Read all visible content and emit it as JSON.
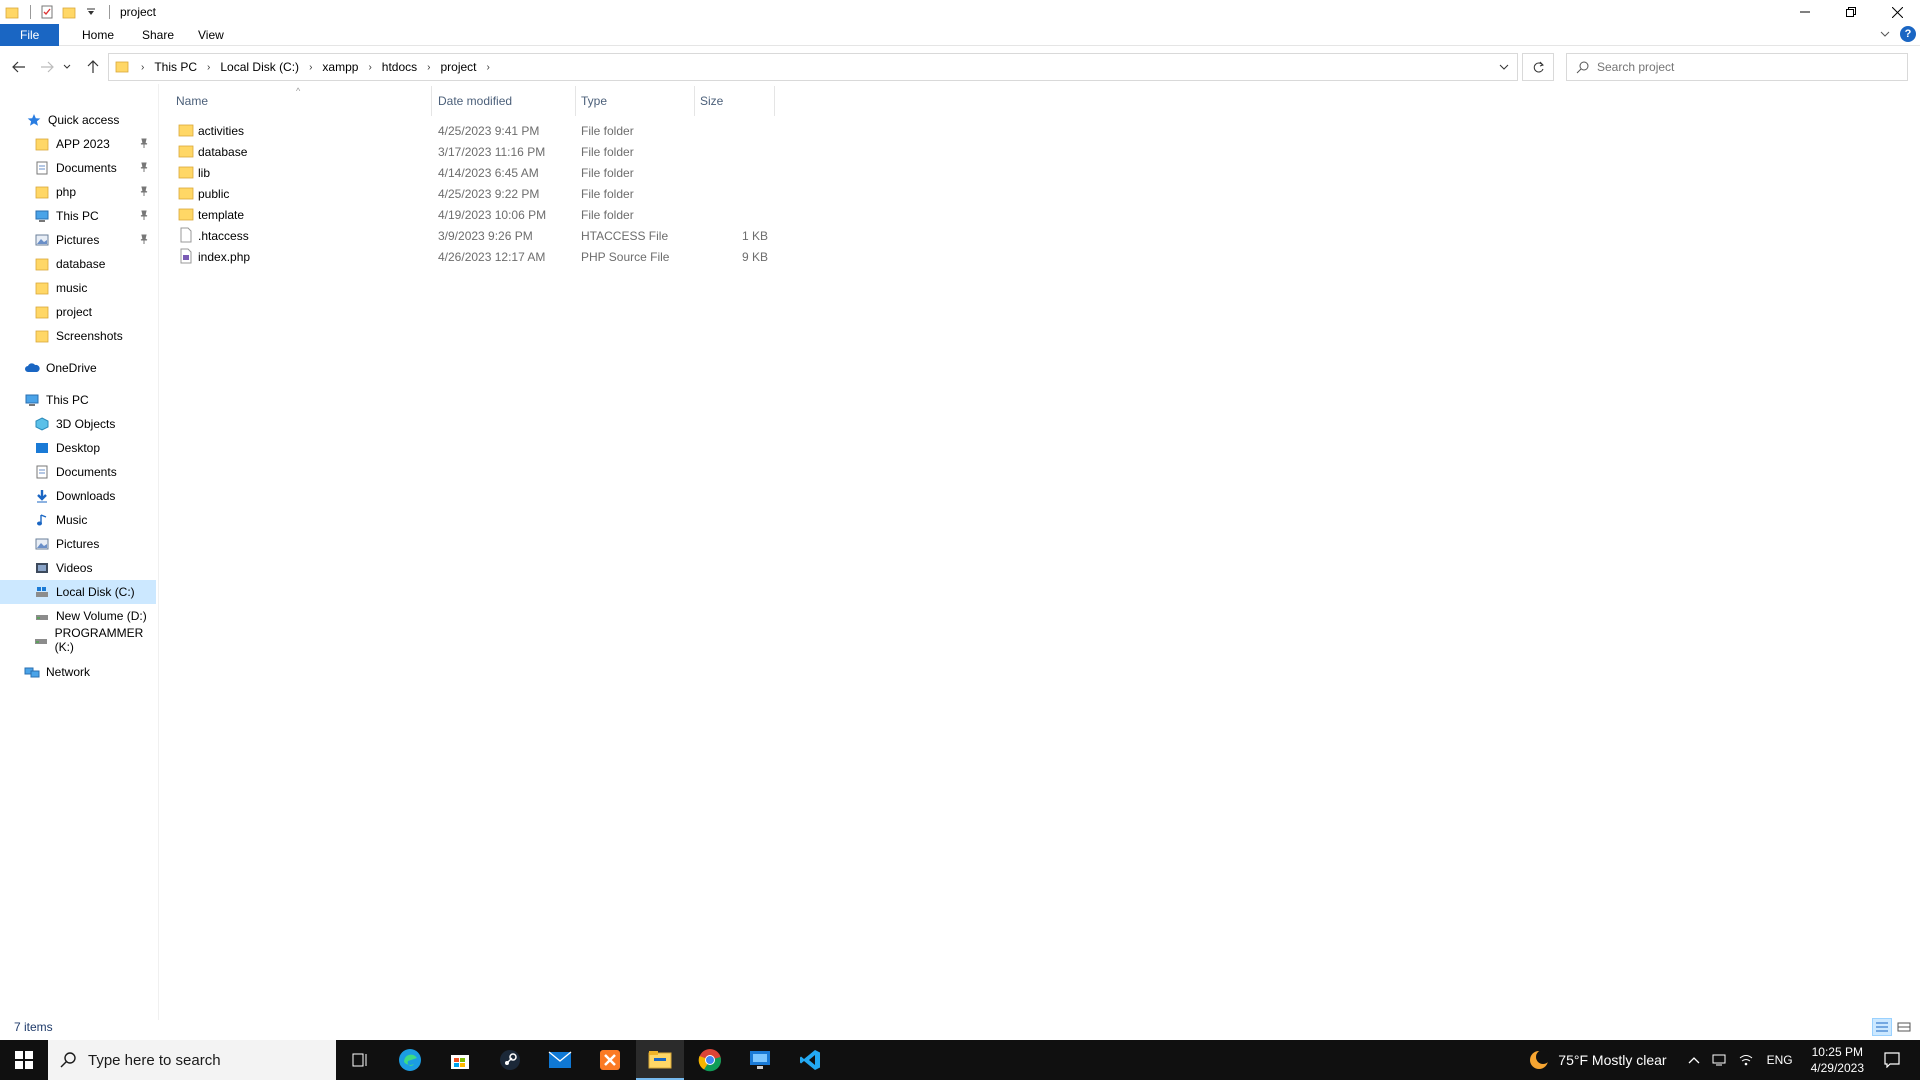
{
  "window": {
    "title": "project"
  },
  "ribbon": {
    "tabs": [
      "File",
      "Home",
      "Share",
      "View"
    ]
  },
  "address": {
    "crumbs": [
      "This PC",
      "Local Disk (C:)",
      "xampp",
      "htdocs",
      "project"
    ]
  },
  "search": {
    "placeholder": "Search project"
  },
  "nav": {
    "quick_access": "Quick access",
    "quick_items": [
      {
        "label": "APP 2023",
        "pinned": true
      },
      {
        "label": "Documents",
        "pinned": true
      },
      {
        "label": "php",
        "pinned": true
      },
      {
        "label": "This PC",
        "pinned": true
      },
      {
        "label": "Pictures",
        "pinned": true
      },
      {
        "label": "database",
        "pinned": false
      },
      {
        "label": "music",
        "pinned": false
      },
      {
        "label": "project",
        "pinned": false
      },
      {
        "label": "Screenshots",
        "pinned": false
      }
    ],
    "onedrive": "OneDrive",
    "this_pc": "This PC",
    "pc_items": [
      "3D Objects",
      "Desktop",
      "Documents",
      "Downloads",
      "Music",
      "Pictures",
      "Videos",
      "Local Disk (C:)",
      "New Volume (D:)",
      "PROGRAMMER (K:)"
    ],
    "selected": "Local Disk (C:)",
    "network": "Network"
  },
  "columns": {
    "name": "Name",
    "date": "Date modified",
    "type": "Type",
    "size": "Size"
  },
  "files": [
    {
      "name": "activities",
      "date": "4/25/2023 9:41 PM",
      "type": "File folder",
      "size": "",
      "kind": "folder"
    },
    {
      "name": "database",
      "date": "3/17/2023 11:16 PM",
      "type": "File folder",
      "size": "",
      "kind": "folder"
    },
    {
      "name": "lib",
      "date": "4/14/2023 6:45 AM",
      "type": "File folder",
      "size": "",
      "kind": "folder"
    },
    {
      "name": "public",
      "date": "4/25/2023 9:22 PM",
      "type": "File folder",
      "size": "",
      "kind": "folder"
    },
    {
      "name": "template",
      "date": "4/19/2023 10:06 PM",
      "type": "File folder",
      "size": "",
      "kind": "folder"
    },
    {
      "name": ".htaccess",
      "date": "3/9/2023 9:26 PM",
      "type": "HTACCESS File",
      "size": "1 KB",
      "kind": "file"
    },
    {
      "name": "index.php",
      "date": "4/26/2023 12:17 AM",
      "type": "PHP Source File",
      "size": "9 KB",
      "kind": "php"
    }
  ],
  "status": {
    "count": "7 items"
  },
  "taskbar": {
    "search_placeholder": "Type here to search",
    "weather": "75°F  Mostly clear",
    "lang": "ENG",
    "time": "10:25 PM",
    "date": "4/29/2023"
  },
  "colors": {
    "accent": "#1a66c3",
    "folder": "#ffd766",
    "selected": "#cce8ff"
  }
}
